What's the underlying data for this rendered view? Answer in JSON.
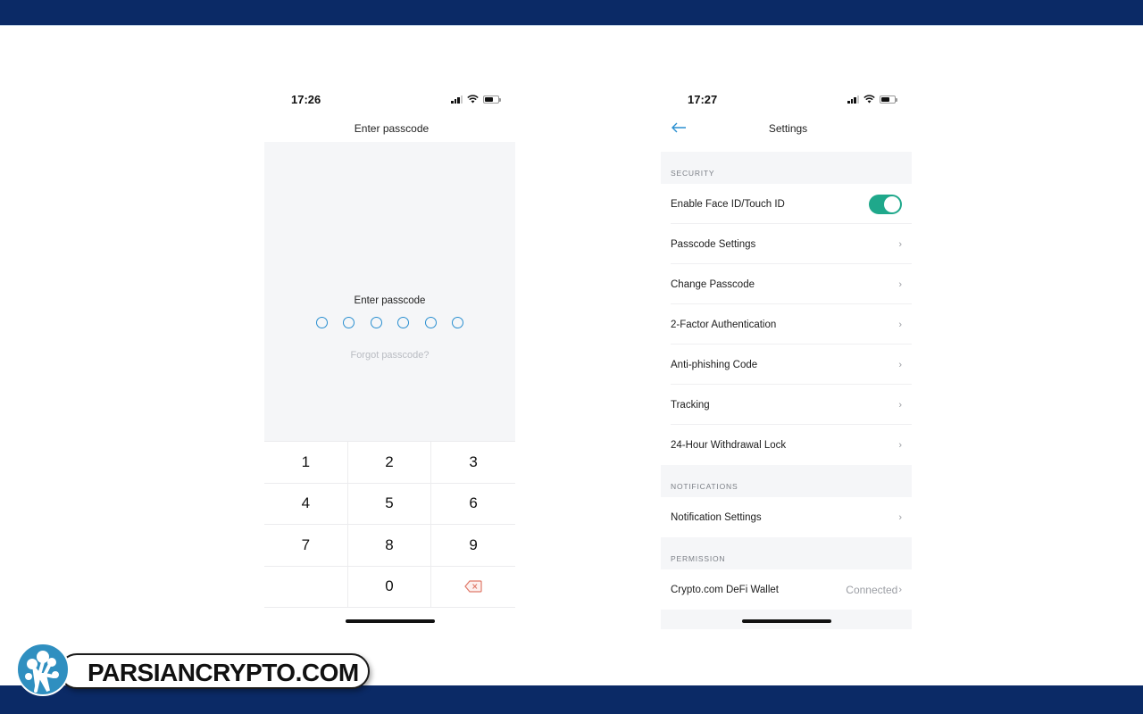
{
  "watermark": {
    "text": "PARSIANCRYPTO.COM"
  },
  "passcode_screen": {
    "status": {
      "time": "17:26"
    },
    "title": "Enter passcode",
    "prompt": "Enter passcode",
    "digits_entered": 0,
    "digits_total": 6,
    "forgot_link": "Forgot passcode?",
    "keys": [
      "1",
      "2",
      "3",
      "4",
      "5",
      "6",
      "7",
      "8",
      "9",
      "",
      "0",
      "backspace"
    ]
  },
  "settings_screen": {
    "status": {
      "time": "17:27"
    },
    "title": "Settings",
    "sections": [
      {
        "header": "SECURITY",
        "rows": [
          {
            "label": "Enable Face ID/Touch ID",
            "type": "toggle",
            "on": true
          },
          {
            "label": "Passcode Settings",
            "type": "chevron"
          },
          {
            "label": "Change Passcode",
            "type": "chevron"
          },
          {
            "label": "2-Factor Authentication",
            "type": "chevron"
          },
          {
            "label": "Anti-phishing Code",
            "type": "chevron"
          },
          {
            "label": "Tracking",
            "type": "chevron"
          },
          {
            "label": "24-Hour Withdrawal Lock",
            "type": "chevron"
          }
        ]
      },
      {
        "header": "NOTIFICATIONS",
        "rows": [
          {
            "label": "Notification Settings",
            "type": "chevron"
          }
        ]
      },
      {
        "header": "PERMISSION",
        "rows": [
          {
            "label": "Crypto.com DeFi Wallet",
            "type": "value",
            "value": "Connected"
          }
        ]
      }
    ]
  },
  "colors": {
    "accent": "#2a8fd0",
    "toggle_on": "#1fa88b",
    "band": "#0b2a66",
    "backspace": "#e07a6a"
  }
}
